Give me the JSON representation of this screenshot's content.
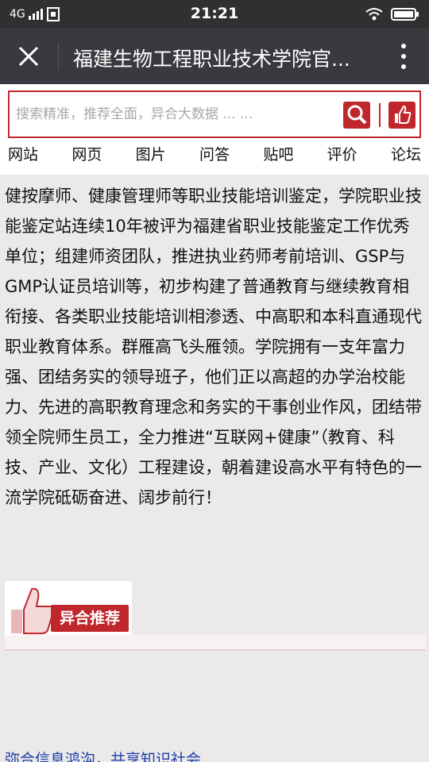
{
  "status_bar": {
    "network": "4G",
    "time": "21:21"
  },
  "title_bar": {
    "title": "福建生物工程职业技术学院官..."
  },
  "search": {
    "placeholder": "搜索精准，推荐全面，异合大数据 ... ..."
  },
  "nav_tabs": [
    "网站",
    "网页",
    "图片",
    "问答",
    "贴吧",
    "评价",
    "论坛"
  ],
  "content": {
    "paragraph": "健按摩师、健康管理师等职业技能培训鉴定，学院职业技能鉴定站连续10年被评为福建省职业技能鉴定工作优秀单位；组建师资团队，推进执业药师考前培训、GSP与GMP认证员培训等，初步构建了普通教育与继续教育相衔接、各类职业技能培训相渗透、中高职和本科直通现代职业教育体系。群雁高飞头雁领。学院拥有一支年富力强、团结务实的领导班子，他们正以高超的办学治校能力、先进的高职教育理念和务实的干事创业作风，团结带领全院师生员工，全力推进“互联网+健康”（教育、科技、产业、文化）工程建设，朝着建设高水平有特色的一流学院砥砺奋进、阔步前行！"
  },
  "ad": {
    "label": "异合推荐"
  },
  "footer": {
    "link": "弥合信息鸿沟，共享知识社会"
  },
  "colors": {
    "brand_red": "#c0272d",
    "title_bar": "#393a3f",
    "status_bar": "#303030"
  }
}
